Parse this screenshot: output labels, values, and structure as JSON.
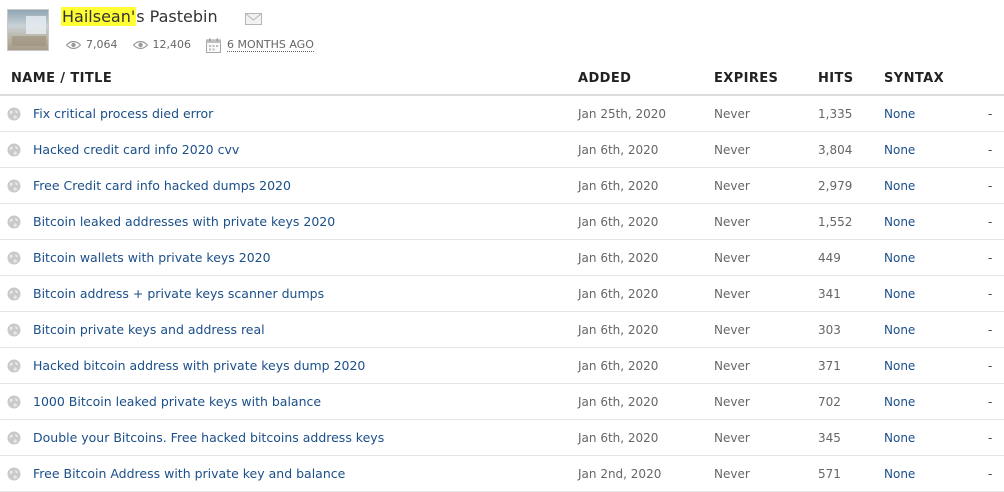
{
  "header": {
    "name_highlight": "Hailsean'",
    "name_rest": "s Pastebin",
    "views": "7,064",
    "total_hits": "12,406",
    "age": "6 MONTHS AGO"
  },
  "columns": {
    "title": "NAME / TITLE",
    "added": "ADDED",
    "expires": "EXPIRES",
    "hits": "HITS",
    "syntax": "SYNTAX"
  },
  "rows": [
    {
      "title": "Fix critical process died error",
      "added": "Jan 25th, 2020",
      "expires": "Never",
      "hits": "1,335",
      "syntax": "None",
      "extra": "-"
    },
    {
      "title": "Hacked credit card info 2020 cvv",
      "added": "Jan 6th, 2020",
      "expires": "Never",
      "hits": "3,804",
      "syntax": "None",
      "extra": "-"
    },
    {
      "title": "Free Credit card info hacked dumps 2020",
      "added": "Jan 6th, 2020",
      "expires": "Never",
      "hits": "2,979",
      "syntax": "None",
      "extra": "-"
    },
    {
      "title": "Bitcoin leaked addresses with private keys 2020",
      "added": "Jan 6th, 2020",
      "expires": "Never",
      "hits": "1,552",
      "syntax": "None",
      "extra": "-"
    },
    {
      "title": "Bitcoin wallets with private keys 2020",
      "added": "Jan 6th, 2020",
      "expires": "Never",
      "hits": "449",
      "syntax": "None",
      "extra": "-"
    },
    {
      "title": "Bitcoin address + private keys scanner dumps",
      "added": "Jan 6th, 2020",
      "expires": "Never",
      "hits": "341",
      "syntax": "None",
      "extra": "-"
    },
    {
      "title": "Bitcoin private keys and address real",
      "added": "Jan 6th, 2020",
      "expires": "Never",
      "hits": "303",
      "syntax": "None",
      "extra": "-"
    },
    {
      "title": "Hacked bitcoin address with private keys dump 2020",
      "added": "Jan 6th, 2020",
      "expires": "Never",
      "hits": "371",
      "syntax": "None",
      "extra": "-"
    },
    {
      "title": "1000 Bitcoin leaked private keys with balance",
      "added": "Jan 6th, 2020",
      "expires": "Never",
      "hits": "702",
      "syntax": "None",
      "extra": "-"
    },
    {
      "title": "Double your Bitcoins. Free hacked bitcoins address keys",
      "added": "Jan 6th, 2020",
      "expires": "Never",
      "hits": "345",
      "syntax": "None",
      "extra": "-"
    },
    {
      "title": "Free Bitcoin Address with private key and balance",
      "added": "Jan 2nd, 2020",
      "expires": "Never",
      "hits": "571",
      "syntax": "None",
      "extra": "-"
    }
  ],
  "icons": {
    "avatar": "user-avatar",
    "mail": "envelope-icon",
    "views": "eye-icon",
    "hits": "eye-icon",
    "date": "calendar-icon",
    "row": "globe-icon"
  },
  "colors": {
    "link": "#1b4f8a",
    "highlight": "#ffff33"
  }
}
